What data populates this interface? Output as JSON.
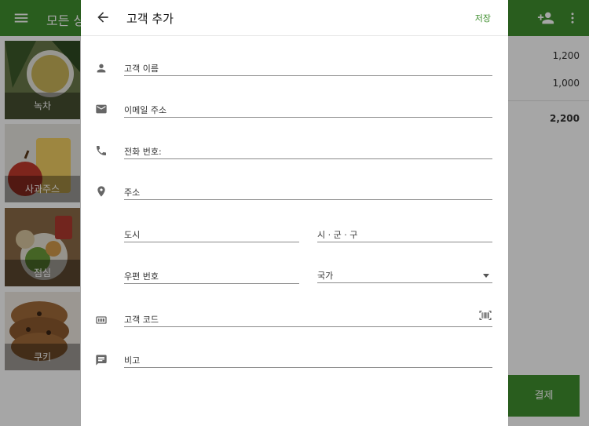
{
  "background": {
    "title": "모든 상",
    "tiles": [
      {
        "label": "녹차"
      },
      {
        "label": "사과주스"
      },
      {
        "label": "점심"
      },
      {
        "label": "쿠키"
      }
    ],
    "order": {
      "amounts": [
        "1,200",
        "1,000"
      ],
      "total": "2,200",
      "pay_label": "결제"
    }
  },
  "dialog": {
    "title": "고객 추가",
    "save_label": "저장",
    "fields": {
      "name": "고객 이름",
      "email": "이메일 주소",
      "phone": "전화 번호:",
      "address": "주소",
      "city": "도시",
      "district": "시 · 군 · 구",
      "postal": "우편 번호",
      "country": "국가",
      "code": "고객 코드",
      "note": "비고"
    }
  },
  "icons": {
    "back": "arrow-left-icon",
    "person": "person-icon",
    "email": "email-icon",
    "phone": "phone-icon",
    "location": "location-pin-icon",
    "card": "id-card-icon",
    "comment": "comment-icon",
    "barcode": "barcode-scan-icon"
  },
  "colors": {
    "accent": "#3f8f2e"
  }
}
